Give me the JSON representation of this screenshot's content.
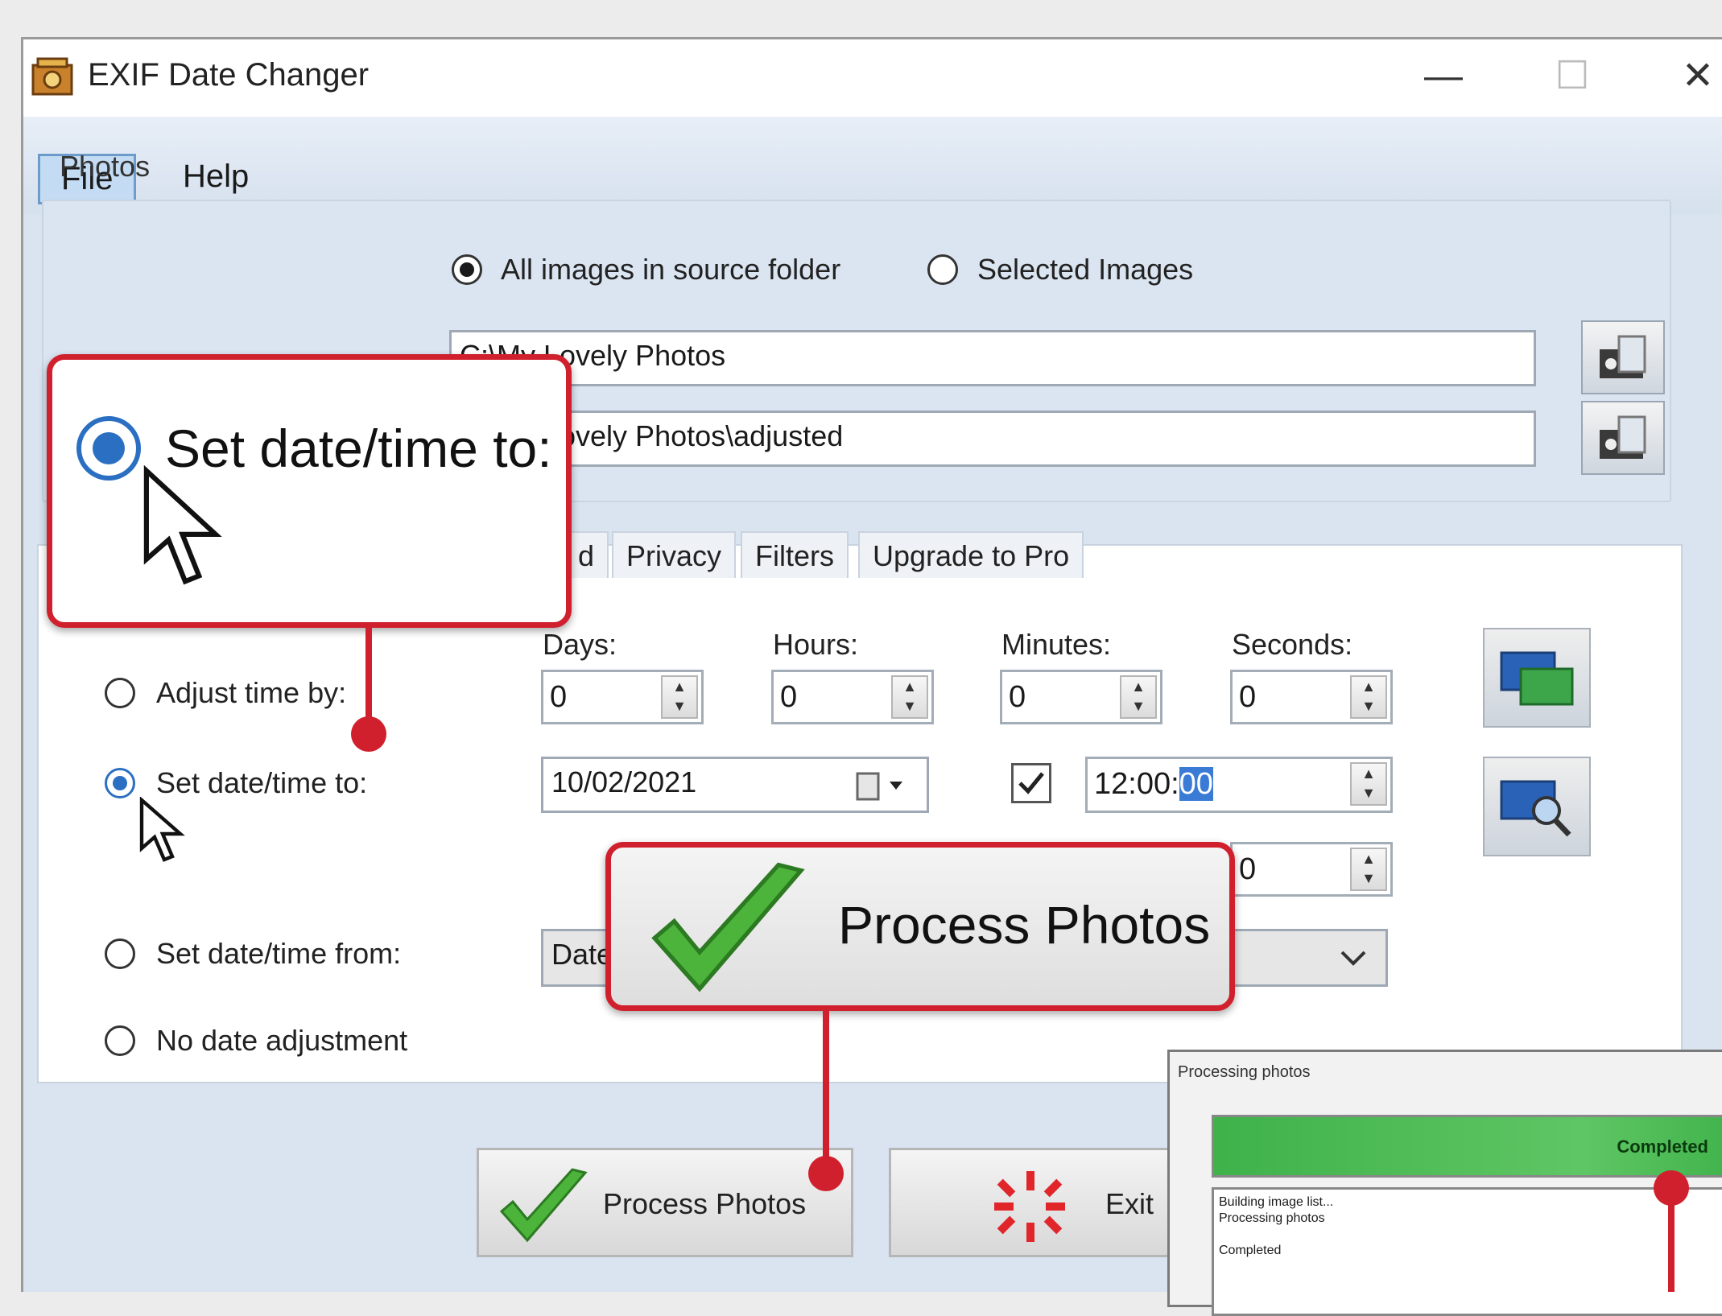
{
  "window": {
    "title": "EXIF Date Changer",
    "minimize": "—",
    "maximize": "☐",
    "close": "✕"
  },
  "menu": {
    "file": "File",
    "help": "Help"
  },
  "photos": {
    "group_label": "Photos",
    "radio_all": "All images in source folder",
    "radio_selected": "Selected Images",
    "source_value": "C:\\My Lovely Photos",
    "dest_value": "C:\\My Lovely Photos\\adjusted"
  },
  "tabs": [
    "d",
    "Privacy",
    "Filters",
    "Upgrade to Pro"
  ],
  "adjust": {
    "days_label": "Days:",
    "hours_label": "Hours:",
    "minutes_label": "Minutes:",
    "seconds_label": "Seconds:",
    "days": "0",
    "hours": "0",
    "minutes": "0",
    "seconds": "0",
    "opt_adjust": "Adjust time by:",
    "opt_set": "Set date/time to:",
    "opt_from": "Set date/time from:",
    "opt_none": "No date adjustment",
    "date_value": "10/02/2021",
    "time_value_main": "12:00:",
    "time_value_sel": "00",
    "extra_value": "0",
    "from_value": "Date"
  },
  "buttons": {
    "process": "Process Photos",
    "exit": "Exit"
  },
  "callouts": {
    "set_datetime": "Set date/time to:",
    "process": "Process Photos"
  },
  "progress": {
    "title": "Processing photos",
    "bar_text": "Completed",
    "log_line1": "Building image list...",
    "log_line2": "Processing photos",
    "log_line3": "Completed"
  },
  "colors": {
    "callout_red": "#d0202d",
    "selection_blue": "#3a7bd5",
    "progress_green": "#3fb24a"
  }
}
